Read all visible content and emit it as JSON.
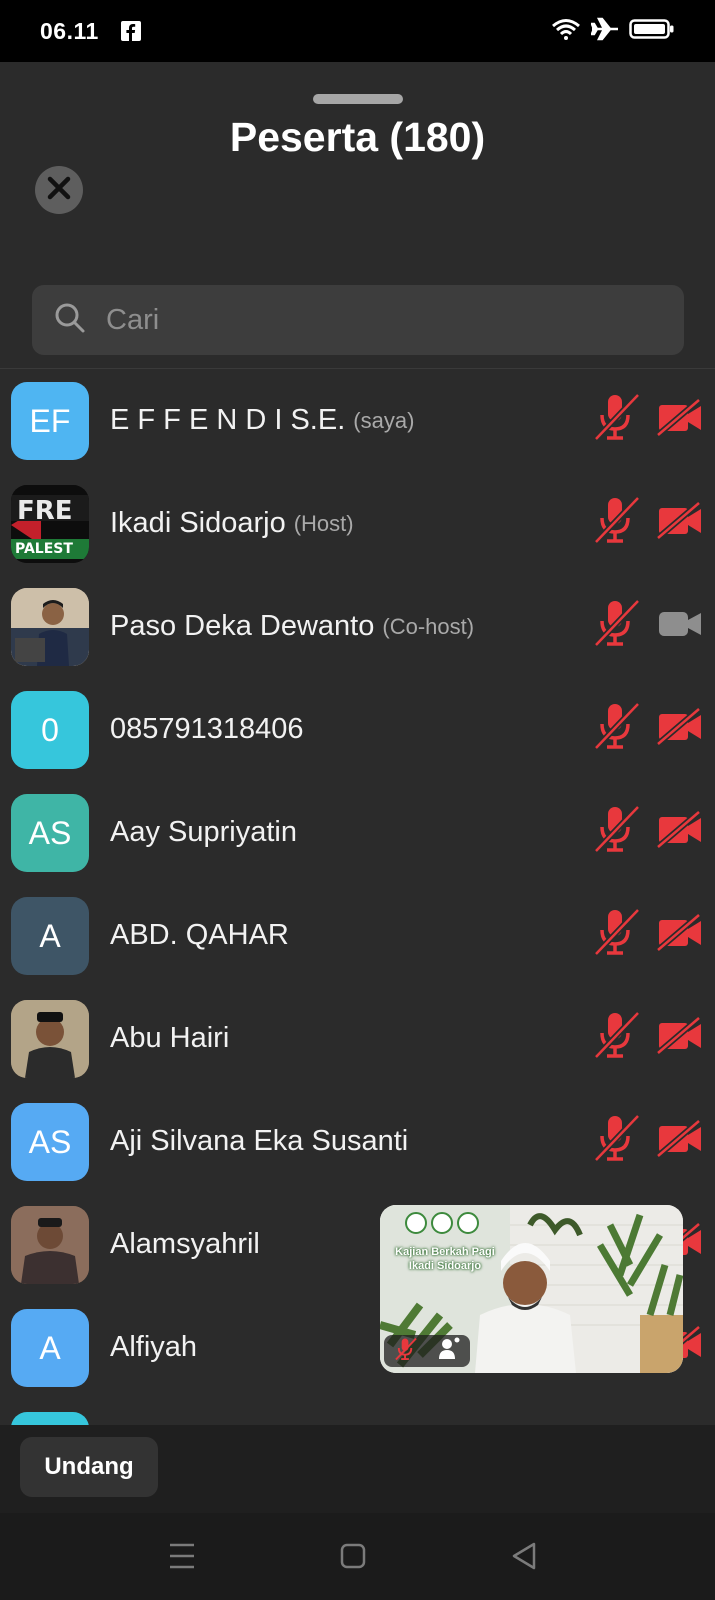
{
  "status_bar": {
    "time": "06.11",
    "icons": [
      "facebook-icon",
      "wifi-icon",
      "airplane-icon",
      "battery-icon"
    ]
  },
  "header": {
    "title": "Peserta (180)",
    "close_icon": "close-icon"
  },
  "search": {
    "placeholder": "Cari",
    "value": ""
  },
  "participants": [
    {
      "initials": "EF",
      "name": "E F F E N D I S.E.",
      "role": "(saya)",
      "avatar_color": "#4fb5f2",
      "mic": "muted",
      "video": "off"
    },
    {
      "initials": "",
      "name": "Ikadi Sidoarjo",
      "role": "(Host)",
      "avatar_color": "#111111",
      "mic": "muted",
      "video": "off"
    },
    {
      "initials": "",
      "name": "Paso Deka Dewanto",
      "role": "(Co-host)",
      "avatar_color": "#c9b9a2",
      "mic": "muted",
      "video": "available"
    },
    {
      "initials": "0",
      "name": "085791318406",
      "role": "",
      "avatar_color": "#36c6dc",
      "mic": "muted",
      "video": "off"
    },
    {
      "initials": "AS",
      "name": "Aay Supriyatin",
      "role": "",
      "avatar_color": "#3fb5a6",
      "mic": "muted",
      "video": "off"
    },
    {
      "initials": "A",
      "name": "ABD. QAHAR",
      "role": "",
      "avatar_color": "#3e5566",
      "mic": "muted",
      "video": "off"
    },
    {
      "initials": "",
      "name": "Abu Hairi",
      "role": "",
      "avatar_color": "#9d8a6e",
      "mic": "muted",
      "video": "off"
    },
    {
      "initials": "AS",
      "name": "Aji Silvana Eka Susanti",
      "role": "",
      "avatar_color": "#56aaf3",
      "mic": "muted",
      "video": "off"
    },
    {
      "initials": "",
      "name": "Alamsyahril",
      "role": "",
      "avatar_color": "#7a5a4a",
      "mic": "muted",
      "video": "off"
    },
    {
      "initials": "A",
      "name": "Alfiyah",
      "role": "",
      "avatar_color": "#56aaf3",
      "mic": "muted",
      "video": "off"
    },
    {
      "initials": "",
      "name": "",
      "role": "",
      "avatar_color": "#36c6dc",
      "mic": "muted",
      "video": "off"
    }
  ],
  "video_preview": {
    "caption_line1": "Kajian Berkah Pagi",
    "caption_line2": "Ikadi Sidoarjo"
  },
  "bottom_bar": {
    "invite_label": "Undang"
  },
  "nav": {
    "icons": [
      "menu-icon",
      "home-icon",
      "back-icon"
    ]
  },
  "colors": {
    "muted_red": "#e8383d",
    "background": "#2b2b2b",
    "search_bg": "#3d3d3d"
  }
}
